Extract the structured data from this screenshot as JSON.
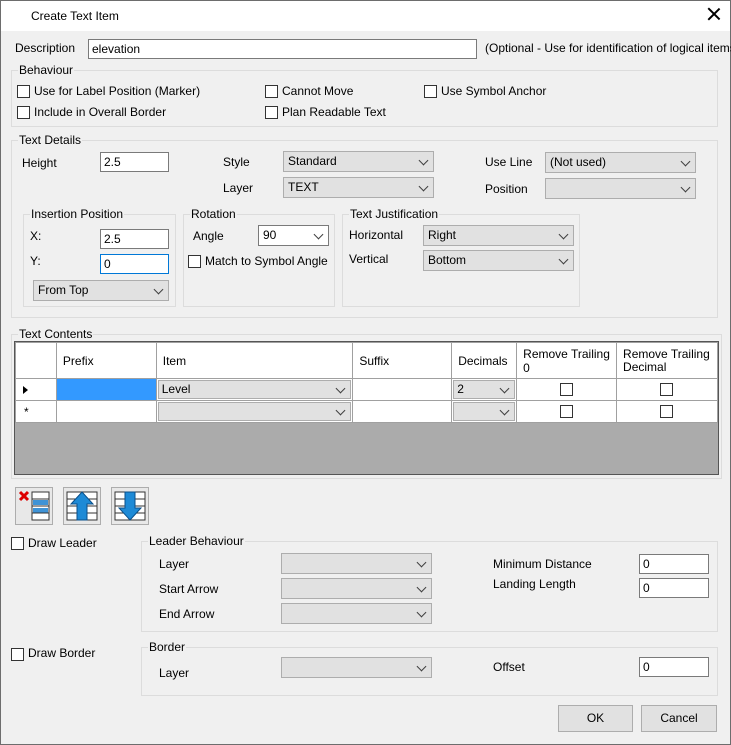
{
  "window": {
    "title": "Create Text Item"
  },
  "description": {
    "label": "Description",
    "value": "elevation",
    "hint": "(Optional - Use for identification of logical items)"
  },
  "behaviour": {
    "title": "Behaviour",
    "use_label_position": "Use for Label Position (Marker)",
    "include_border": "Include in Overall Border",
    "cannot_move": "Cannot Move",
    "plan_readable": "Plan Readable Text",
    "use_symbol_anchor": "Use Symbol Anchor"
  },
  "text_details": {
    "title": "Text Details",
    "height_label": "Height",
    "height_value": "2.5",
    "style_label": "Style",
    "style_value": "Standard",
    "layer_label": "Layer",
    "layer_value": "TEXT",
    "use_line_label": "Use Line",
    "use_line_value": "(Not used)",
    "position_label": "Position",
    "position_value": ""
  },
  "insertion": {
    "title": "Insertion Position",
    "x_label": "X:",
    "x_value": "2.5",
    "y_label": "Y:",
    "y_value": "0",
    "from_value": "From Top"
  },
  "rotation": {
    "title": "Rotation",
    "angle_label": "Angle",
    "angle_value": "90",
    "match_label": "Match to Symbol Angle"
  },
  "justification": {
    "title": "Text Justification",
    "horizontal_label": "Horizontal",
    "horizontal_value": "Right",
    "vertical_label": "Vertical",
    "vertical_value": "Bottom"
  },
  "contents": {
    "title": "Text Contents",
    "columns": [
      "Prefix",
      "Item",
      "Suffix",
      "Decimals",
      "Remove Trailing 0",
      "Remove Trailing Decimal"
    ],
    "row1": {
      "prefix": "",
      "item": "Level",
      "suffix": "",
      "decimals": "2"
    },
    "new_row_marker": "*"
  },
  "leader": {
    "draw_label": "Draw Leader",
    "title": "Leader Behaviour",
    "layer_label": "Layer",
    "start_arrow_label": "Start Arrow",
    "end_arrow_label": "End Arrow",
    "min_distance_label": "Minimum Distance",
    "min_distance_value": "0",
    "landing_label": "Landing Length",
    "landing_value": "0"
  },
  "border": {
    "draw_label": "Draw Border",
    "title": "Border",
    "layer_label": "Layer",
    "offset_label": "Offset",
    "offset_value": "0"
  },
  "buttons": {
    "ok": "OK",
    "cancel": "Cancel"
  }
}
